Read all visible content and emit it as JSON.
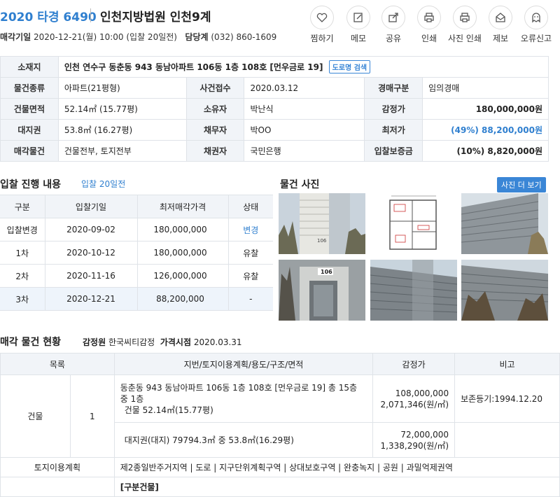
{
  "header": {
    "case_no": "2020 타경 6490",
    "court": "인천지방법원 인천9계",
    "sale_date_label": "매각기일",
    "sale_date": "2020-12-21(월) 10:00 (입찰 20일전)",
    "phone_label": "담당계",
    "phone": "(032) 860-1609"
  },
  "actions": [
    {
      "label": "찜하기",
      "icon": "heart-icon"
    },
    {
      "label": "메모",
      "icon": "memo-icon"
    },
    {
      "label": "공유",
      "icon": "share-icon"
    },
    {
      "label": "인쇄",
      "icon": "print-icon"
    },
    {
      "label": "사진 인쇄",
      "icon": "photo-print-icon"
    },
    {
      "label": "제보",
      "icon": "report-icon"
    },
    {
      "label": "오류신고",
      "icon": "error-report-icon"
    }
  ],
  "info": {
    "location_label": "소재지",
    "location": "인천 연수구 동춘동 943 동남아파트 106동 1층 108호 [먼우금로 19]",
    "road_search": "도로명 검색",
    "type_label": "물건종류",
    "type": "아파트(21평형)",
    "received_label": "사건접수",
    "received": "2020.03.12",
    "auction_type_label": "경매구분",
    "auction_type": "임의경매",
    "area_label": "건물면적",
    "area": "52.14㎡ (15.77평)",
    "owner_label": "소유자",
    "owner": "박난식",
    "appraisal_label": "감정가",
    "appraisal": "180,000,000원",
    "land_label": "대지권",
    "land": "53.8㎡ (16.27평)",
    "debtor_label": "채무자",
    "debtor": "박OO",
    "min_price_label": "최저가",
    "min_price": "(49%) 88,200,000원",
    "sale_items_label": "매각물건",
    "sale_items": "건물전부, 토지전부",
    "creditor_label": "채권자",
    "creditor": "국민은행",
    "deposit_label": "입찰보증금",
    "deposit": "(10%) 8,820,000원"
  },
  "bid": {
    "title": "입찰 진행 내용",
    "days": "입찰 20일전",
    "headers": [
      "구분",
      "입찰기일",
      "최저매각가격",
      "상태"
    ],
    "rows": [
      [
        "입찰변경",
        "2020-09-02",
        "180,000,000",
        "변경"
      ],
      [
        "1차",
        "2020-10-12",
        "180,000,000",
        "유찰"
      ],
      [
        "2차",
        "2020-11-16",
        "126,000,000",
        "유찰"
      ],
      [
        "3차",
        "2020-12-21",
        "88,200,000",
        "-"
      ]
    ]
  },
  "photos": {
    "title": "물건 사진",
    "more": "사진 더 보기",
    "building_no": "106"
  },
  "sale": {
    "title": "매각 물건 현황",
    "appraiser_label": "감정원",
    "appraiser": "한국씨티감정",
    "price_date_label": "가격시점",
    "price_date": "2020.03.31",
    "headers": [
      "목록",
      "지번/토지이용계획/용도/구조/면적",
      "감정가",
      "비고"
    ],
    "building_label": "건물",
    "building_no": "1",
    "building_desc1": "동춘동 943 동남아파트 106동 1층 108호 [먼우금로 19] 총 15층 중 1층",
    "building_desc2": "건물 52.14㎡(15.77평)",
    "building_price": "108,000,000",
    "building_unit": "2,071,346(원/㎡)",
    "note": "보존등기:1994.12.20",
    "land_desc": "대지권(대지) 79794.3㎡ 중 53.8㎡(16.29평)",
    "land_price": "72,000,000",
    "land_unit": "1,338,290(원/㎡)",
    "landuse_label": "토지이용계획",
    "landuse": "제2종일반주거지역 | 도로 | 지구단위계획구역 | 상대보호구역 | 완충녹지 | 공원 | 과밀억제권역",
    "next_label": "[구분건물]"
  }
}
